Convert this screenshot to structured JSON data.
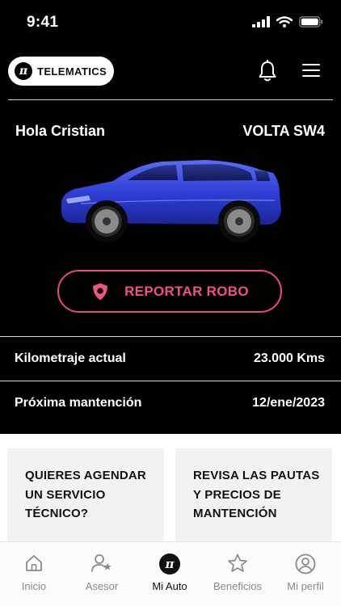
{
  "status_bar": {
    "time": "9:41"
  },
  "header": {
    "logo_mark": "π",
    "logo_text": "TELEMATICS"
  },
  "greeting": "Hola Cristian",
  "vehicle": {
    "model": "VOLTA SW4",
    "color": "#2f3fd6"
  },
  "report_button": {
    "label": "REPORTAR ROBO"
  },
  "info": {
    "mileage_label": "Kilometraje actual",
    "mileage_value": "23.000 Kms",
    "maintenance_label": "Próxima mantención",
    "maintenance_value": "12/ene/2023"
  },
  "cards": [
    {
      "text": "QUIERES AGENDAR\nUN SERVICIO\nTÉCNICO?"
    },
    {
      "text": "REVISA LAS PAUTAS\nY PRECIOS DE\nMANTENCIÓN"
    }
  ],
  "tabs": [
    {
      "label": "Inicio",
      "icon": "home-icon",
      "active": false
    },
    {
      "label": "Asesor",
      "icon": "advisor-icon",
      "active": false
    },
    {
      "label": "Mi Auto",
      "icon": "logo-icon",
      "active": true
    },
    {
      "label": "Beneficios",
      "icon": "star-icon",
      "active": false
    },
    {
      "label": "Mi perfil",
      "icon": "profile-icon",
      "active": false
    }
  ],
  "colors": {
    "accent": "#ec5583",
    "background": "#000000"
  }
}
